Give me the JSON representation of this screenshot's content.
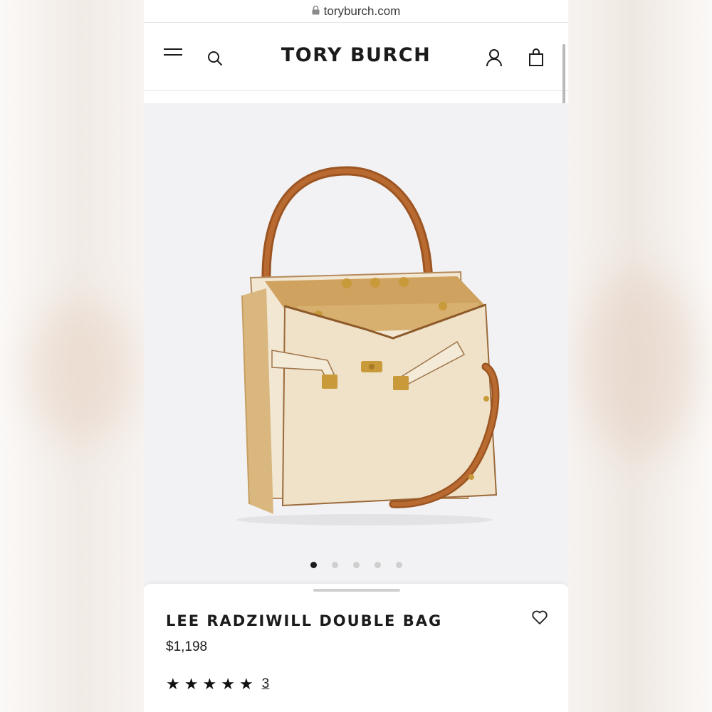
{
  "browser": {
    "url": "toryburch.com"
  },
  "header": {
    "brand": "TORY BURCH",
    "icons": [
      "menu-icon",
      "search-icon",
      "account-icon",
      "shopping-bag-icon"
    ]
  },
  "gallery": {
    "image_count": 5,
    "active_index": 0
  },
  "product": {
    "name": "LEE RADZIWILL DOUBLE BAG",
    "price": "$1,198",
    "rating": 5,
    "review_count": "3",
    "wishlist_icon": "heart-icon"
  },
  "colors": {
    "text": "#1b1b1b",
    "gallery_background": "#f2f2f4",
    "dot_inactive": "#cfcfcf",
    "bag_body": "#efe3cc",
    "leather_strap": "#a05a26",
    "hardware": "#c99a3a"
  }
}
